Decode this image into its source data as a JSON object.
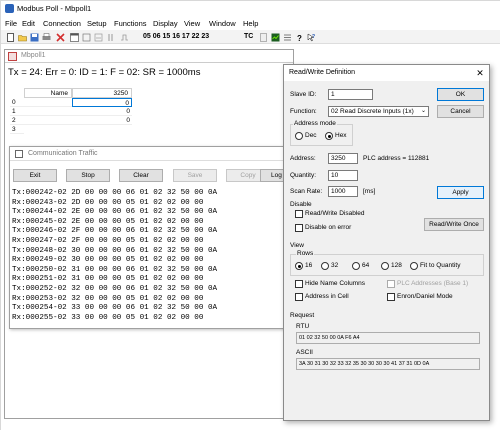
{
  "app": {
    "title": "Modbus Poll - Mbpoll1",
    "menu": [
      "File",
      "Edit",
      "Connection",
      "Setup",
      "Functions",
      "Display",
      "View",
      "Window",
      "Help"
    ],
    "toolbar_fc": "05 06 15 16 17 22 23",
    "toolbar_tc": "TC"
  },
  "child": {
    "title": "Mbpoll1",
    "status": "Tx = 24: Err = 0: ID = 1: F = 02: SR = 1000ms",
    "grid": {
      "header_name": "Name",
      "header_value": "3250",
      "rows": [
        {
          "no": "0",
          "value": "0"
        },
        {
          "no": "1",
          "value": "0"
        },
        {
          "no": "2",
          "value": "0"
        },
        {
          "no": "3",
          "value": ""
        }
      ]
    }
  },
  "traffic": {
    "title": "Communication Traffic",
    "buttons": {
      "exit": "Exit",
      "stop": "Stop",
      "clear": "Clear",
      "save": "Save",
      "copy": "Copy",
      "log": "Log"
    },
    "lines": [
      "Tx:000242-02 2D 00 00 00 06 01 02 32 50 00 0A",
      "Rx:000243-02 2D 00 00 00 05 01 02 02 00 00",
      "Tx:000244-02 2E 00 00 00 06 01 02 32 50 00 0A",
      "Rx:000245-02 2E 00 00 00 05 01 02 02 00 00",
      "Tx:000246-02 2F 00 00 00 06 01 02 32 50 00 0A",
      "Rx:000247-02 2F 00 00 00 05 01 02 02 00 00",
      "Tx:000248-02 30 00 00 00 06 01 02 32 50 00 0A",
      "Rx:000249-02 30 00 00 00 05 01 02 02 00 00",
      "Tx:000250-02 31 00 00 00 06 01 02 32 50 00 0A",
      "Rx:000251-02 31 00 00 00 05 01 02 02 00 00",
      "Tx:000252-02 32 00 00 00 06 01 02 32 50 00 0A",
      "Rx:000253-02 32 00 00 00 05 01 02 02 00 00",
      "Tx:000254-02 33 00 00 00 06 01 02 32 50 00 0A",
      "Rx:000255-02 33 00 00 00 05 01 02 02 00 00"
    ]
  },
  "dialog": {
    "title": "Read/Write Definition",
    "slave_id_label": "Slave ID:",
    "slave_id": "1",
    "ok": "OK",
    "function_label": "Function:",
    "function_value": "02 Read Discrete Inputs (1x)",
    "cancel": "Cancel",
    "address_mode_label": "Address mode",
    "dec_label": "Dec",
    "hex_label": "Hex",
    "address_mode_selected": "Hex",
    "address_label": "Address:",
    "address": "3250",
    "plc_address": "PLC address = 112881",
    "quantity_label": "Quantity:",
    "quantity": "10",
    "scan_rate_label": "Scan Rate:",
    "scan_rate": "1000",
    "scan_rate_unit": "[ms]",
    "apply": "Apply",
    "disable_group": "Disable",
    "rw_disabled": "Read/Write Disabled",
    "disable_on_error": "Disable on error",
    "rw_once": "Read/Write Once",
    "view_group": "View",
    "rows_group": "Rows",
    "rows_options": [
      "16",
      "32",
      "64",
      "128",
      "Fit to Quantity"
    ],
    "rows_selected": "16",
    "hide_name_columns": "Hide Name Columns",
    "plc_addresses_base1": "PLC Addresses (Base 1)",
    "address_in_cell": "Address in Cell",
    "enron_daniel": "Enron/Daniel Mode",
    "request_group": "Request",
    "rtu_label": "RTU",
    "rtu_value": "01 02 32 50 00 0A F6 A4",
    "ascii_label": "ASCII",
    "ascii_value": "3A 30 31 30 32 33 32 35 30 30 30 30 41 37 31 0D 0A"
  },
  "colors": {
    "accent": "#0078d7",
    "dialog_bg": "#f0f0f0",
    "selected_cell": "#0078d7"
  }
}
